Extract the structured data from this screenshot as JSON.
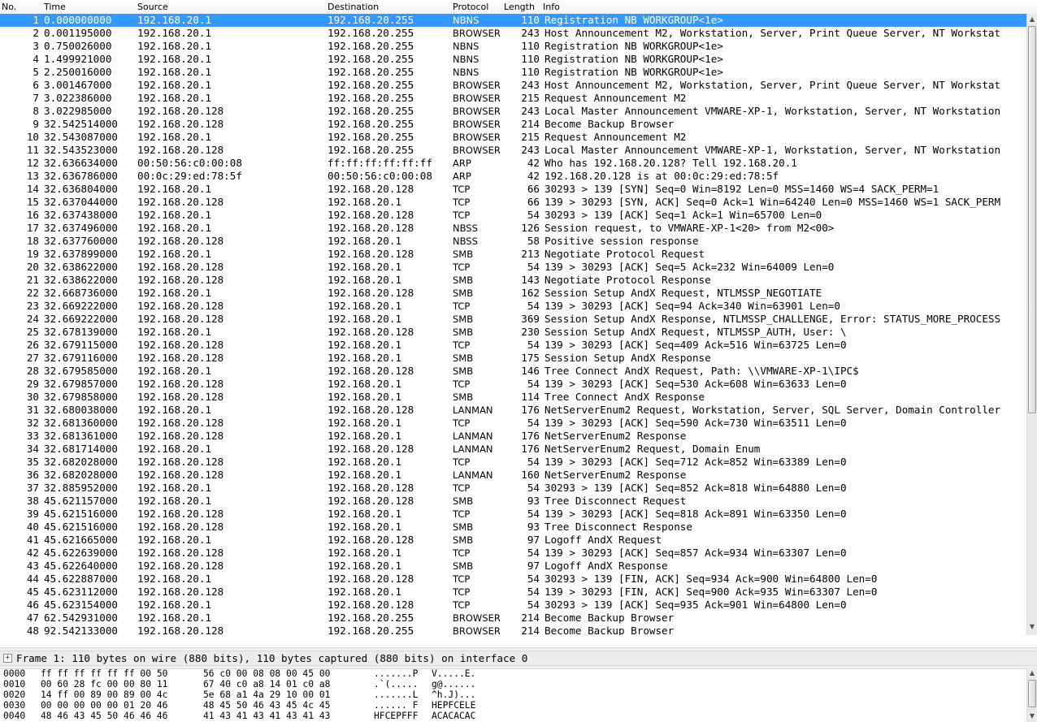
{
  "columns": {
    "no": "No.",
    "time": "Time",
    "source": "Source",
    "destination": "Destination",
    "protocol": "Protocol",
    "length": "Length",
    "info": "Info"
  },
  "packets": [
    {
      "no": "1",
      "time": "0.000000000",
      "src": "192.168.20.1",
      "dst": "192.168.20.255",
      "proto": "NBNS",
      "len": "110",
      "info": "Registration NB WORKGROUP<1e>"
    },
    {
      "no": "2",
      "time": "0.001195000",
      "src": "192.168.20.1",
      "dst": "192.168.20.255",
      "proto": "BROWSER",
      "len": "243",
      "info": "Host Announcement M2, Workstation, Server, Print Queue Server, NT Workstat"
    },
    {
      "no": "3",
      "time": "0.750026000",
      "src": "192.168.20.1",
      "dst": "192.168.20.255",
      "proto": "NBNS",
      "len": "110",
      "info": "Registration NB WORKGROUP<1e>"
    },
    {
      "no": "4",
      "time": "1.499921000",
      "src": "192.168.20.1",
      "dst": "192.168.20.255",
      "proto": "NBNS",
      "len": "110",
      "info": "Registration NB WORKGROUP<1e>"
    },
    {
      "no": "5",
      "time": "2.250016000",
      "src": "192.168.20.1",
      "dst": "192.168.20.255",
      "proto": "NBNS",
      "len": "110",
      "info": "Registration NB WORKGROUP<1e>"
    },
    {
      "no": "6",
      "time": "3.001467000",
      "src": "192.168.20.1",
      "dst": "192.168.20.255",
      "proto": "BROWSER",
      "len": "243",
      "info": "Host Announcement M2, Workstation, Server, Print Queue Server, NT Workstat"
    },
    {
      "no": "7",
      "time": "3.022386000",
      "src": "192.168.20.1",
      "dst": "192.168.20.255",
      "proto": "BROWSER",
      "len": "215",
      "info": "Request Announcement M2"
    },
    {
      "no": "8",
      "time": "3.022985000",
      "src": "192.168.20.128",
      "dst": "192.168.20.255",
      "proto": "BROWSER",
      "len": "243",
      "info": "Local Master Announcement VMWARE-XP-1, Workstation, Server, NT Workstation"
    },
    {
      "no": "9",
      "time": "32.542514000",
      "src": "192.168.20.128",
      "dst": "192.168.20.255",
      "proto": "BROWSER",
      "len": "214",
      "info": "Become Backup Browser"
    },
    {
      "no": "10",
      "time": "32.543087000",
      "src": "192.168.20.1",
      "dst": "192.168.20.255",
      "proto": "BROWSER",
      "len": "215",
      "info": "Request Announcement M2"
    },
    {
      "no": "11",
      "time": "32.543523000",
      "src": "192.168.20.128",
      "dst": "192.168.20.255",
      "proto": "BROWSER",
      "len": "243",
      "info": "Local Master Announcement VMWARE-XP-1, Workstation, Server, NT Workstation"
    },
    {
      "no": "12",
      "time": "32.636634000",
      "src": "00:50:56:c0:00:08",
      "dst": "ff:ff:ff:ff:ff:ff",
      "proto": "ARP",
      "len": "42",
      "info": "Who has 192.168.20.128?  Tell 192.168.20.1"
    },
    {
      "no": "13",
      "time": "32.636786000",
      "src": "00:0c:29:ed:78:5f",
      "dst": "00:50:56:c0:00:08",
      "proto": "ARP",
      "len": "42",
      "info": "192.168.20.128 is at 00:0c:29:ed:78:5f"
    },
    {
      "no": "14",
      "time": "32.636804000",
      "src": "192.168.20.1",
      "dst": "192.168.20.128",
      "proto": "TCP",
      "len": "66",
      "info": "30293 > 139 [SYN] Seq=0 Win=8192 Len=0 MSS=1460 WS=4 SACK_PERM=1"
    },
    {
      "no": "15",
      "time": "32.637044000",
      "src": "192.168.20.128",
      "dst": "192.168.20.1",
      "proto": "TCP",
      "len": "66",
      "info": "139 > 30293 [SYN, ACK] Seq=0 Ack=1 Win=64240 Len=0 MSS=1460 WS=1 SACK_PERM"
    },
    {
      "no": "16",
      "time": "32.637438000",
      "src": "192.168.20.1",
      "dst": "192.168.20.128",
      "proto": "TCP",
      "len": "54",
      "info": "30293 > 139 [ACK] Seq=1 Ack=1 Win=65700 Len=0"
    },
    {
      "no": "17",
      "time": "32.637496000",
      "src": "192.168.20.1",
      "dst": "192.168.20.128",
      "proto": "NBSS",
      "len": "126",
      "info": "Session request, to VMWARE-XP-1<20> from M2<00>"
    },
    {
      "no": "18",
      "time": "32.637760000",
      "src": "192.168.20.128",
      "dst": "192.168.20.1",
      "proto": "NBSS",
      "len": "58",
      "info": "Positive session response"
    },
    {
      "no": "19",
      "time": "32.637899000",
      "src": "192.168.20.1",
      "dst": "192.168.20.128",
      "proto": "SMB",
      "len": "213",
      "info": "Negotiate Protocol Request"
    },
    {
      "no": "20",
      "time": "32.638622000",
      "src": "192.168.20.128",
      "dst": "192.168.20.1",
      "proto": "TCP",
      "len": "54",
      "info": "139 > 30293 [ACK] Seq=5 Ack=232 Win=64009 Len=0"
    },
    {
      "no": "21",
      "time": "32.638622000",
      "src": "192.168.20.128",
      "dst": "192.168.20.1",
      "proto": "SMB",
      "len": "143",
      "info": "Negotiate Protocol Response"
    },
    {
      "no": "22",
      "time": "32.668736000",
      "src": "192.168.20.1",
      "dst": "192.168.20.128",
      "proto": "SMB",
      "len": "162",
      "info": "Session Setup AndX Request, NTLMSSP_NEGOTIATE"
    },
    {
      "no": "23",
      "time": "32.669222000",
      "src": "192.168.20.128",
      "dst": "192.168.20.1",
      "proto": "TCP",
      "len": "54",
      "info": "139 > 30293 [ACK] Seq=94 Ack=340 Win=63901 Len=0"
    },
    {
      "no": "24",
      "time": "32.669222000",
      "src": "192.168.20.128",
      "dst": "192.168.20.1",
      "proto": "SMB",
      "len": "369",
      "info": "Session Setup AndX Response, NTLMSSP_CHALLENGE, Error: STATUS_MORE_PROCESS"
    },
    {
      "no": "25",
      "time": "32.678139000",
      "src": "192.168.20.1",
      "dst": "192.168.20.128",
      "proto": "SMB",
      "len": "230",
      "info": "Session Setup AndX Request, NTLMSSP_AUTH, User: \\"
    },
    {
      "no": "26",
      "time": "32.679115000",
      "src": "192.168.20.128",
      "dst": "192.168.20.1",
      "proto": "TCP",
      "len": "54",
      "info": "139 > 30293 [ACK] Seq=409 Ack=516 Win=63725 Len=0"
    },
    {
      "no": "27",
      "time": "32.679116000",
      "src": "192.168.20.128",
      "dst": "192.168.20.1",
      "proto": "SMB",
      "len": "175",
      "info": "Session Setup AndX Response"
    },
    {
      "no": "28",
      "time": "32.679585000",
      "src": "192.168.20.1",
      "dst": "192.168.20.128",
      "proto": "SMB",
      "len": "146",
      "info": "Tree Connect AndX Request, Path: \\\\VMWARE-XP-1\\IPC$"
    },
    {
      "no": "29",
      "time": "32.679857000",
      "src": "192.168.20.128",
      "dst": "192.168.20.1",
      "proto": "TCP",
      "len": "54",
      "info": "139 > 30293 [ACK] Seq=530 Ack=608 Win=63633 Len=0"
    },
    {
      "no": "30",
      "time": "32.679858000",
      "src": "192.168.20.128",
      "dst": "192.168.20.1",
      "proto": "SMB",
      "len": "114",
      "info": "Tree Connect AndX Response"
    },
    {
      "no": "31",
      "time": "32.680038000",
      "src": "192.168.20.1",
      "dst": "192.168.20.128",
      "proto": "LANMAN",
      "len": "176",
      "info": "NetServerEnum2 Request, Workstation, Server, SQL Server, Domain Controller"
    },
    {
      "no": "32",
      "time": "32.681360000",
      "src": "192.168.20.128",
      "dst": "192.168.20.1",
      "proto": "TCP",
      "len": "54",
      "info": "139 > 30293 [ACK] Seq=590 Ack=730 Win=63511 Len=0"
    },
    {
      "no": "33",
      "time": "32.681361000",
      "src": "192.168.20.128",
      "dst": "192.168.20.1",
      "proto": "LANMAN",
      "len": "176",
      "info": "NetServerEnum2 Response"
    },
    {
      "no": "34",
      "time": "32.681714000",
      "src": "192.168.20.1",
      "dst": "192.168.20.128",
      "proto": "LANMAN",
      "len": "176",
      "info": "NetServerEnum2 Request, Domain Enum"
    },
    {
      "no": "35",
      "time": "32.682028000",
      "src": "192.168.20.128",
      "dst": "192.168.20.1",
      "proto": "TCP",
      "len": "54",
      "info": "139 > 30293 [ACK] Seq=712 Ack=852 Win=63389 Len=0"
    },
    {
      "no": "36",
      "time": "32.682028000",
      "src": "192.168.20.128",
      "dst": "192.168.20.1",
      "proto": "LANMAN",
      "len": "160",
      "info": "NetServerEnum2 Response"
    },
    {
      "no": "37",
      "time": "32.885952000",
      "src": "192.168.20.1",
      "dst": "192.168.20.128",
      "proto": "TCP",
      "len": "54",
      "info": "30293 > 139 [ACK] Seq=852 Ack=818 Win=64880 Len=0"
    },
    {
      "no": "38",
      "time": "45.621157000",
      "src": "192.168.20.1",
      "dst": "192.168.20.128",
      "proto": "SMB",
      "len": "93",
      "info": "Tree Disconnect Request"
    },
    {
      "no": "39",
      "time": "45.621516000",
      "src": "192.168.20.128",
      "dst": "192.168.20.1",
      "proto": "TCP",
      "len": "54",
      "info": "139 > 30293 [ACK] Seq=818 Ack=891 Win=63350 Len=0"
    },
    {
      "no": "40",
      "time": "45.621516000",
      "src": "192.168.20.128",
      "dst": "192.168.20.1",
      "proto": "SMB",
      "len": "93",
      "info": "Tree Disconnect Response"
    },
    {
      "no": "41",
      "time": "45.621665000",
      "src": "192.168.20.1",
      "dst": "192.168.20.128",
      "proto": "SMB",
      "len": "97",
      "info": "Logoff AndX Request"
    },
    {
      "no": "42",
      "time": "45.622639000",
      "src": "192.168.20.128",
      "dst": "192.168.20.1",
      "proto": "TCP",
      "len": "54",
      "info": "139 > 30293 [ACK] Seq=857 Ack=934 Win=63307 Len=0"
    },
    {
      "no": "43",
      "time": "45.622640000",
      "src": "192.168.20.128",
      "dst": "192.168.20.1",
      "proto": "SMB",
      "len": "97",
      "info": "Logoff AndX Response"
    },
    {
      "no": "44",
      "time": "45.622887000",
      "src": "192.168.20.1",
      "dst": "192.168.20.128",
      "proto": "TCP",
      "len": "54",
      "info": "30293 > 139 [FIN, ACK] Seq=934 Ack=900 Win=64800 Len=0"
    },
    {
      "no": "45",
      "time": "45.623112000",
      "src": "192.168.20.128",
      "dst": "192.168.20.1",
      "proto": "TCP",
      "len": "54",
      "info": "139 > 30293 [FIN, ACK] Seq=900 Ack=935 Win=63307 Len=0"
    },
    {
      "no": "46",
      "time": "45.623154000",
      "src": "192.168.20.1",
      "dst": "192.168.20.128",
      "proto": "TCP",
      "len": "54",
      "info": "30293 > 139 [ACK] Seq=935 Ack=901 Win=64800 Len=0"
    },
    {
      "no": "47",
      "time": "62.542931000",
      "src": "192.168.20.1",
      "dst": "192.168.20.255",
      "proto": "BROWSER",
      "len": "214",
      "info": "Become Backup Browser"
    },
    {
      "no": "48",
      "time": "92.542133000",
      "src": "192.168.20.128",
      "dst": "192.168.20.255",
      "proto": "BROWSER",
      "len": "214",
      "info": "Become Backup Browser"
    }
  ],
  "selected_packet_index": 0,
  "selection_color": "#3399ff",
  "scroll_grip_glyph": "|||",
  "detail": {
    "expander": "+",
    "frame_summary": "Frame 1: 110 bytes on wire (880 bits), 110 bytes captured (880 bits) on interface 0"
  },
  "hex_dump": [
    {
      "offset": "0000",
      "hex1": "ff ff ff ff ff ff 00 50",
      "hex2": "56 c0 00 08 08 00 45 00",
      "ascii1": ".......P",
      "ascii2": "V.....E."
    },
    {
      "offset": "0010",
      "hex1": "00 60 28 fc 00 00 80 11",
      "hex2": "67 40 c0 a8 14 01 c0 a8",
      "ascii1": ".`(.....",
      "ascii2": "g@......"
    },
    {
      "offset": "0020",
      "hex1": "14 ff 00 89 00 89 00 4c",
      "hex2": "5e 68 a1 4a 29 10 00 01",
      "ascii1": ".......L",
      "ascii2": "^h.J)..."
    },
    {
      "offset": "0030",
      "hex1": "00 00 00 00 00 01 20 46",
      "hex2": "48 45 50 46 43 45 4c 45",
      "ascii1": "...... F",
      "ascii2": "HEPFCELE"
    },
    {
      "offset": "0040",
      "hex1": "48 46 43 45 50 46 46 46",
      "hex2": "41 43 41 43 41 43 41 43",
      "ascii1": "HFCEPFFF",
      "ascii2": "ACACACAC"
    }
  ]
}
